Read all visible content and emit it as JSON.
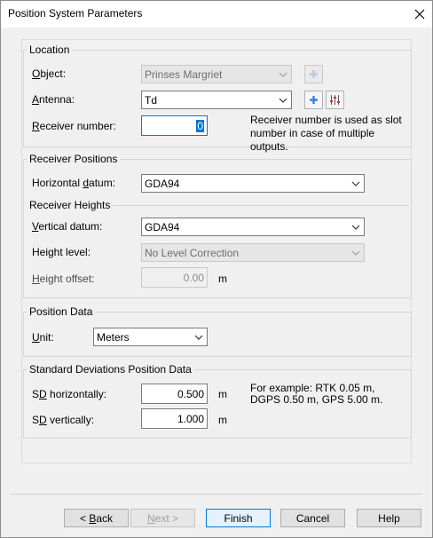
{
  "window": {
    "title": "Position System Parameters"
  },
  "location": {
    "group_title": "Location",
    "object_label": "Object:",
    "object_value": "Prinses Margriet",
    "antenna_label": "Antenna:",
    "antenna_value": "Td",
    "receiver_label": "Receiver number:",
    "receiver_value": "0",
    "receiver_note": "Receiver number is used as slot number in case of multiple outputs."
  },
  "receiver_positions": {
    "group_title": "Receiver Positions",
    "horizontal_datum_label": "Horizontal datum:",
    "horizontal_datum_value": "GDA94"
  },
  "receiver_heights": {
    "group_title": "Receiver Heights",
    "vertical_datum_label": "Vertical datum:",
    "vertical_datum_value": "GDA94",
    "height_level_label": "Height level:",
    "height_level_value": "No Level Correction",
    "height_offset_label": "Height offset:",
    "height_offset_value": "0.00",
    "height_offset_unit": "m"
  },
  "position_data": {
    "group_title": "Position Data",
    "unit_label": "Unit:",
    "unit_value": "Meters"
  },
  "std_dev": {
    "group_title": "Standard Deviations Position Data",
    "sd_h_label": "SD horizontally:",
    "sd_h_value": "0.500",
    "sd_h_unit": "m",
    "sd_v_label": "SD vertically:",
    "sd_v_value": "1.000",
    "sd_v_unit": "m",
    "example_line1": "For example: RTK 0.05 m,",
    "example_line2": "DGPS 0.50 m, GPS 5.00 m."
  },
  "buttons": {
    "back": "< Back",
    "next": "Next >",
    "finish": "Finish",
    "cancel": "Cancel",
    "help": "Help"
  },
  "colors": {
    "accent": "#0078d7",
    "plus_icon": "#3d7fd6"
  },
  "icons": [
    "close-icon",
    "plus-icon",
    "settings-sliders-icon",
    "chevron-down-icon"
  ]
}
